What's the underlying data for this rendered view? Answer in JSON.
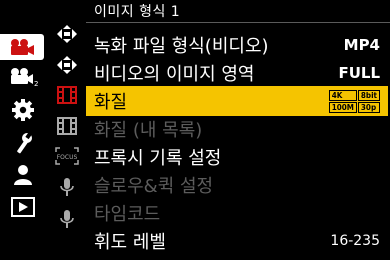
{
  "header": {
    "title": "이미지 형식 1"
  },
  "main_tabs": [
    {
      "icon": "movie-camera-icon",
      "active": true
    },
    {
      "icon": "movie-camera-2-icon",
      "active": false
    },
    {
      "icon": "gear-icon",
      "active": false
    },
    {
      "icon": "wrench-icon",
      "active": false
    },
    {
      "icon": "person-icon",
      "active": false
    },
    {
      "icon": "playback-icon",
      "active": false
    }
  ],
  "sub_tabs": [
    {
      "icon": "focus-arrows-icon"
    },
    {
      "icon": "focus-arrows-icon"
    },
    {
      "icon": "film-strip-icon",
      "active": true
    },
    {
      "icon": "film-strip-icon"
    },
    {
      "icon": "focus-frame-icon",
      "label": "FOCUS"
    },
    {
      "icon": "microphone-icon"
    },
    {
      "icon": "microphone-icon"
    }
  ],
  "menu": {
    "items": [
      {
        "label": "녹화 파일 형식(비디오)",
        "value": "MP4",
        "disabled": false,
        "selected": false
      },
      {
        "label": "비디오의 이미지 영역",
        "value": "FULL",
        "disabled": false,
        "selected": false
      },
      {
        "label": "화질",
        "value": "",
        "disabled": false,
        "selected": true
      },
      {
        "label": "화질 (내 목록)",
        "value": "",
        "disabled": true,
        "selected": false
      },
      {
        "label": "프록시 기록 설정",
        "value": "",
        "disabled": false,
        "selected": false
      },
      {
        "label": "슬로우&퀵 설정",
        "value": "",
        "disabled": true,
        "selected": false
      },
      {
        "label": "타임코드",
        "value": "",
        "disabled": true,
        "selected": false
      },
      {
        "label": "휘도 레벨",
        "value": "16-235",
        "disabled": false,
        "selected": false
      }
    ],
    "quality_badge": [
      "4K",
      "8bit",
      "100M",
      "30p"
    ]
  },
  "colors": {
    "accent": "#f5c400",
    "active_tab_icon": "#cc1111",
    "disabled_text": "#5c5c5c"
  }
}
